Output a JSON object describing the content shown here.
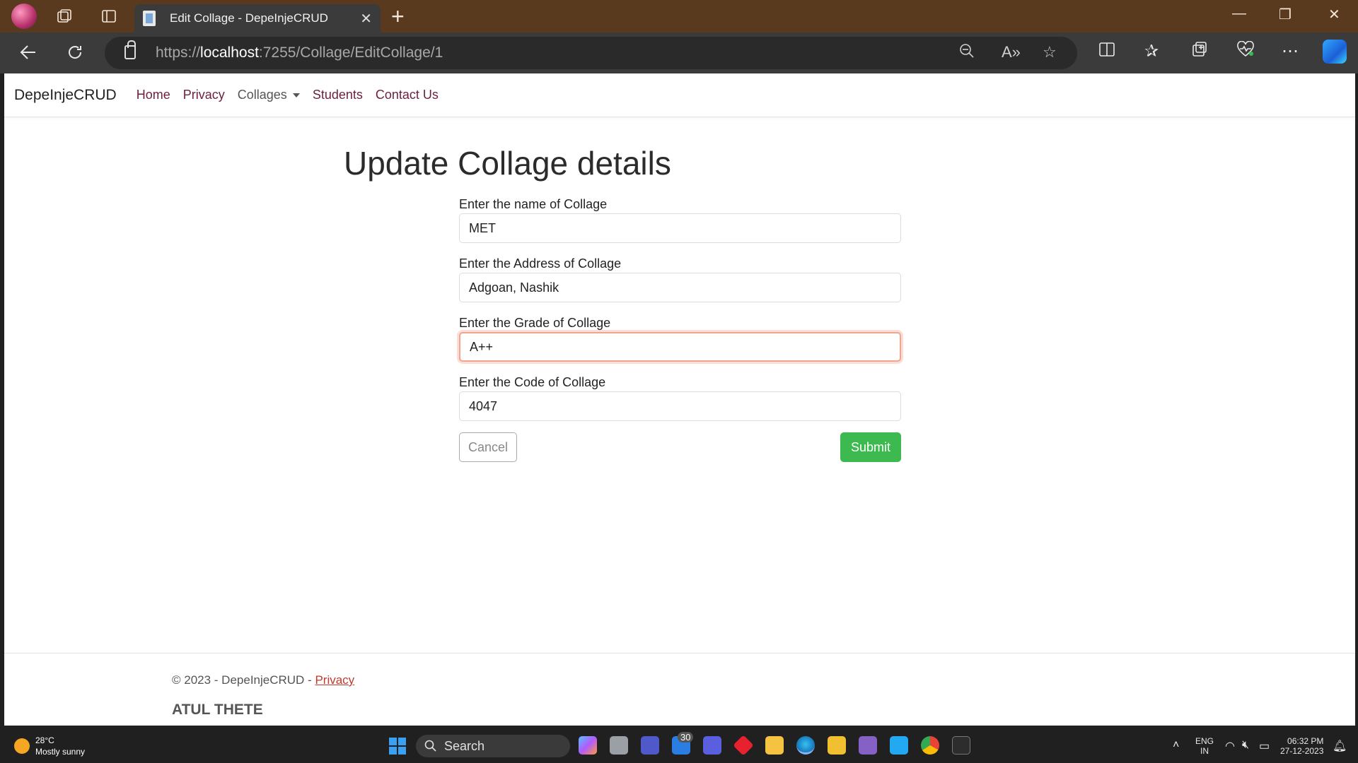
{
  "browser": {
    "tab_title": "Edit Collage - DepeInjeCRUD",
    "tab_close": "✕",
    "new_tab": "+",
    "url_prefix": "https://",
    "url_host": "localhost",
    "url_path": ":7255/Collage/EditCollage/1"
  },
  "navbar": {
    "brand": "DepeInjeCRUD",
    "links": [
      "Home",
      "Privacy",
      "Collages",
      "Students",
      "Contact Us"
    ]
  },
  "page": {
    "title": "Update Collage details"
  },
  "form": {
    "name_label": "Enter the name of Collage",
    "name_value": "MET",
    "address_label": "Enter the Address of Collage",
    "address_value": "Adgoan, Nashik",
    "grade_label": "Enter the Grade of Collage",
    "grade_value": "A++",
    "code_label": "Enter the Code of Collage",
    "code_value": "4047",
    "cancel_label": "Cancel",
    "submit_label": "Submit",
    "submit_color": "#3cb94f"
  },
  "footer": {
    "copyright": "© 2023 - DepeInjeCRUD - ",
    "privacy_link": "Privacy",
    "author": "ATUL THETE"
  },
  "taskbar": {
    "temperature": "28°C",
    "weather": "Mostly sunny",
    "search_label": "Search",
    "mail_badge": "30",
    "lang_line1": "ENG",
    "lang_line2": "IN",
    "time": "06:32 PM",
    "date": "27-12-2023"
  },
  "icons": {
    "back": "back-arrow-icon",
    "refresh": "refresh-icon",
    "zoom": "zoom-out-icon",
    "read_aloud": "read-aloud-icon",
    "favorite": "star-icon",
    "split": "split-screen-icon",
    "favorites": "favorites-icon",
    "collections": "collections-icon",
    "health": "browser-essentials-icon",
    "more": "more-icon"
  }
}
